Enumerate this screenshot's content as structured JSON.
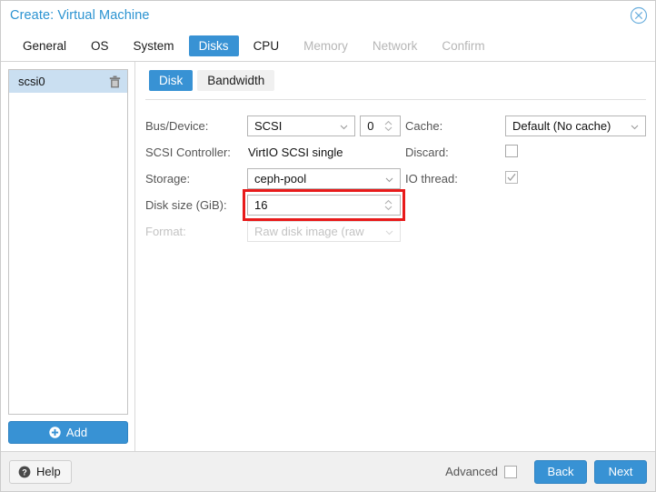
{
  "window": {
    "title": "Create: Virtual Machine",
    "close_icon": "close-circle-icon",
    "accent_color": "#3892d4",
    "title_color": "#2b93d1",
    "annotation_color": "#e81b1b"
  },
  "tabs": [
    {
      "label": "General",
      "state": "enabled"
    },
    {
      "label": "OS",
      "state": "enabled"
    },
    {
      "label": "System",
      "state": "enabled"
    },
    {
      "label": "Disks",
      "state": "active"
    },
    {
      "label": "CPU",
      "state": "enabled"
    },
    {
      "label": "Memory",
      "state": "disabled"
    },
    {
      "label": "Network",
      "state": "disabled"
    },
    {
      "label": "Confirm",
      "state": "disabled"
    }
  ],
  "disk_list": {
    "items": [
      {
        "label": "scsi0",
        "selected": true,
        "delete_icon": "trash-icon"
      }
    ],
    "add_button": {
      "label": "Add",
      "icon": "plus-circle-icon"
    }
  },
  "subtabs": [
    {
      "label": "Disk",
      "state": "active"
    },
    {
      "label": "Bandwidth",
      "state": "enabled"
    }
  ],
  "form": {
    "left": {
      "bus_device": {
        "label": "Bus/Device:",
        "bus_value": "SCSI",
        "device_value": "0"
      },
      "scsi_controller": {
        "label": "SCSI Controller:",
        "value": "VirtIO SCSI single"
      },
      "storage": {
        "label": "Storage:",
        "value": "ceph-pool"
      },
      "disk_size": {
        "label": "Disk size (GiB):",
        "value": "16",
        "highlighted": true
      },
      "format": {
        "label": "Format:",
        "value": "Raw disk image (raw",
        "disabled": true
      }
    },
    "right": {
      "cache": {
        "label": "Cache:",
        "value": "Default (No cache)"
      },
      "discard": {
        "label": "Discard:",
        "checked": false
      },
      "io_thread": {
        "label": "IO thread:",
        "checked": true
      }
    }
  },
  "footer": {
    "help": {
      "label": "Help",
      "icon": "help-circle-icon"
    },
    "advanced": {
      "label": "Advanced",
      "checked": false
    },
    "back": {
      "label": "Back"
    },
    "next": {
      "label": "Next"
    }
  }
}
